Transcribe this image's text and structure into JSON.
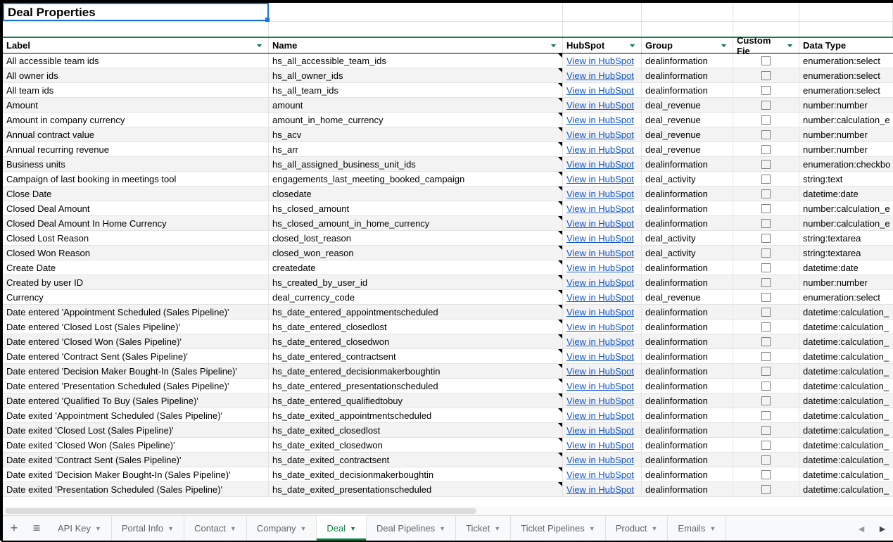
{
  "title": "Deal Properties",
  "headers": {
    "label": "Label",
    "name": "Name",
    "hubspot": "HubSpot",
    "group": "Group",
    "custom": "Custom Fie",
    "datatype": "Data Type"
  },
  "link_text": "View in HubSpot",
  "rows": [
    {
      "label": "All accessible team ids",
      "name": "hs_all_accessible_team_ids",
      "group": "dealinformation",
      "custom": false,
      "type": "enumeration:select"
    },
    {
      "label": "All owner ids",
      "name": "hs_all_owner_ids",
      "group": "dealinformation",
      "custom": false,
      "type": "enumeration:select"
    },
    {
      "label": "All team ids",
      "name": "hs_all_team_ids",
      "group": "dealinformation",
      "custom": false,
      "type": "enumeration:select"
    },
    {
      "label": "Amount",
      "name": "amount",
      "group": "deal_revenue",
      "custom": false,
      "type": "number:number"
    },
    {
      "label": "Amount in company currency",
      "name": "amount_in_home_currency",
      "group": "deal_revenue",
      "custom": false,
      "type": "number:calculation_e"
    },
    {
      "label": "Annual contract value",
      "name": "hs_acv",
      "group": "deal_revenue",
      "custom": false,
      "type": "number:number"
    },
    {
      "label": "Annual recurring revenue",
      "name": "hs_arr",
      "group": "deal_revenue",
      "custom": false,
      "type": "number:number"
    },
    {
      "label": "Business units",
      "name": "hs_all_assigned_business_unit_ids",
      "group": "dealinformation",
      "custom": false,
      "type": "enumeration:checkbo"
    },
    {
      "label": "Campaign of last booking in meetings tool",
      "name": "engagements_last_meeting_booked_campaign",
      "group": "deal_activity",
      "custom": false,
      "type": "string:text"
    },
    {
      "label": "Close Date",
      "name": "closedate",
      "group": "dealinformation",
      "custom": false,
      "type": "datetime:date"
    },
    {
      "label": "Closed Deal Amount",
      "name": "hs_closed_amount",
      "group": "dealinformation",
      "custom": false,
      "type": "number:calculation_e"
    },
    {
      "label": "Closed Deal Amount In Home Currency",
      "name": "hs_closed_amount_in_home_currency",
      "group": "dealinformation",
      "custom": false,
      "type": "number:calculation_e"
    },
    {
      "label": "Closed Lost Reason",
      "name": "closed_lost_reason",
      "group": "deal_activity",
      "custom": false,
      "type": "string:textarea"
    },
    {
      "label": "Closed Won Reason",
      "name": "closed_won_reason",
      "group": "deal_activity",
      "custom": false,
      "type": "string:textarea"
    },
    {
      "label": "Create Date",
      "name": "createdate",
      "group": "dealinformation",
      "custom": false,
      "type": "datetime:date"
    },
    {
      "label": "Created by user ID",
      "name": "hs_created_by_user_id",
      "group": "dealinformation",
      "custom": false,
      "type": "number:number"
    },
    {
      "label": "Currency",
      "name": "deal_currency_code",
      "group": "deal_revenue",
      "custom": false,
      "type": "enumeration:select"
    },
    {
      "label": "Date entered 'Appointment Scheduled (Sales Pipeline)'",
      "name": "hs_date_entered_appointmentscheduled",
      "group": "dealinformation",
      "custom": false,
      "type": "datetime:calculation_"
    },
    {
      "label": "Date entered 'Closed Lost (Sales Pipeline)'",
      "name": "hs_date_entered_closedlost",
      "group": "dealinformation",
      "custom": false,
      "type": "datetime:calculation_"
    },
    {
      "label": "Date entered 'Closed Won (Sales Pipeline)'",
      "name": "hs_date_entered_closedwon",
      "group": "dealinformation",
      "custom": false,
      "type": "datetime:calculation_"
    },
    {
      "label": "Date entered 'Contract Sent (Sales Pipeline)'",
      "name": "hs_date_entered_contractsent",
      "group": "dealinformation",
      "custom": false,
      "type": "datetime:calculation_"
    },
    {
      "label": "Date entered 'Decision Maker Bought-In (Sales Pipeline)'",
      "name": "hs_date_entered_decisionmakerboughtin",
      "group": "dealinformation",
      "custom": false,
      "type": "datetime:calculation_"
    },
    {
      "label": "Date entered 'Presentation Scheduled (Sales Pipeline)'",
      "name": "hs_date_entered_presentationscheduled",
      "group": "dealinformation",
      "custom": false,
      "type": "datetime:calculation_"
    },
    {
      "label": "Date entered 'Qualified To Buy (Sales Pipeline)'",
      "name": "hs_date_entered_qualifiedtobuy",
      "group": "dealinformation",
      "custom": false,
      "type": "datetime:calculation_"
    },
    {
      "label": "Date exited 'Appointment Scheduled (Sales Pipeline)'",
      "name": "hs_date_exited_appointmentscheduled",
      "group": "dealinformation",
      "custom": false,
      "type": "datetime:calculation_"
    },
    {
      "label": "Date exited 'Closed Lost (Sales Pipeline)'",
      "name": "hs_date_exited_closedlost",
      "group": "dealinformation",
      "custom": false,
      "type": "datetime:calculation_"
    },
    {
      "label": "Date exited 'Closed Won (Sales Pipeline)'",
      "name": "hs_date_exited_closedwon",
      "group": "dealinformation",
      "custom": false,
      "type": "datetime:calculation_"
    },
    {
      "label": "Date exited 'Contract Sent (Sales Pipeline)'",
      "name": "hs_date_exited_contractsent",
      "group": "dealinformation",
      "custom": false,
      "type": "datetime:calculation_"
    },
    {
      "label": "Date exited 'Decision Maker Bought-In (Sales Pipeline)'",
      "name": "hs_date_exited_decisionmakerboughtin",
      "group": "dealinformation",
      "custom": false,
      "type": "datetime:calculation_"
    },
    {
      "label": "Date exited 'Presentation Scheduled (Sales Pipeline)'",
      "name": "hs_date_exited_presentationscheduled",
      "group": "dealinformation",
      "custom": false,
      "type": "datetime:calculation_"
    }
  ],
  "tabs": [
    {
      "label": "API Key",
      "active": false
    },
    {
      "label": "Portal Info",
      "active": false
    },
    {
      "label": "Contact",
      "active": false
    },
    {
      "label": "Company",
      "active": false
    },
    {
      "label": "Deal",
      "active": true
    },
    {
      "label": "Deal Pipelines",
      "active": false
    },
    {
      "label": "Ticket",
      "active": false
    },
    {
      "label": "Ticket Pipelines",
      "active": false
    },
    {
      "label": "Product",
      "active": false
    },
    {
      "label": "Emails",
      "active": false
    }
  ],
  "icons": {
    "add": "+",
    "menu": "≡",
    "dropdown": "▼",
    "filter": "▼",
    "left": "◄",
    "right": "►"
  }
}
